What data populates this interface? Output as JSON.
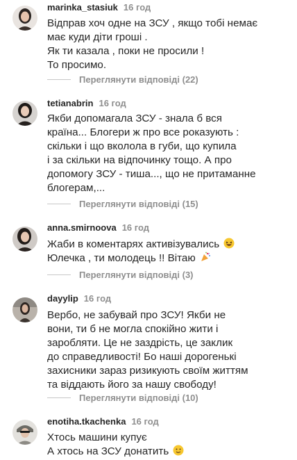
{
  "comments": [
    {
      "username": "marinka_stasiuk",
      "time": "16 год",
      "lines": [
        "Відправ хоч одне на ЗСУ , якщо тобі немає",
        "має куди діти гроші .",
        "Як ти казала , поки не просили !",
        "То просимо."
      ],
      "replies": "Переглянути відповіді (22)"
    },
    {
      "username": "tetianabrin",
      "time": "16 год",
      "lines": [
        "Якби допомагала ЗСУ - знала б вся",
        "країна... Блогери ж про все роказують :",
        "скільки і що вколола в губи, що купила",
        "і за скільки на відпочинку тощо. А про",
        "допомогу ЗСУ - тиша..., що не притаманне",
        "блогерам,..."
      ],
      "replies": "Переглянути відповіді (15)"
    },
    {
      "username": "anna.smirnoova",
      "time": "16 год",
      "lines": [
        "Жаби в коментарях активізувались",
        "Юлечка , ти молодець !! Вітаю"
      ],
      "replies": "Переглянути відповіді (3)"
    },
    {
      "username": "dayylip",
      "time": "16 год",
      "lines": [
        "Вербо, не забувай про ЗСУ! Якби не",
        "вони, ти б не могла спокійно жити і",
        "заробляти. Це не заздрість, це заклик",
        "до справедливості! Бо наші дорогенькі",
        "захисники зараз ризикують своїм життям",
        "та віддають його за нашу свободу!"
      ],
      "replies": "Переглянути відповіді (10)"
    },
    {
      "username": "enotiha.tkachenka",
      "time": "16 год",
      "lines": [
        "Хтось машини купує",
        "А хтось на ЗСУ донатить"
      ]
    }
  ],
  "emojis": {
    "laugh": "grinning-squinting-face",
    "party": "party-popper",
    "smile": "slightly-smiling-face"
  }
}
